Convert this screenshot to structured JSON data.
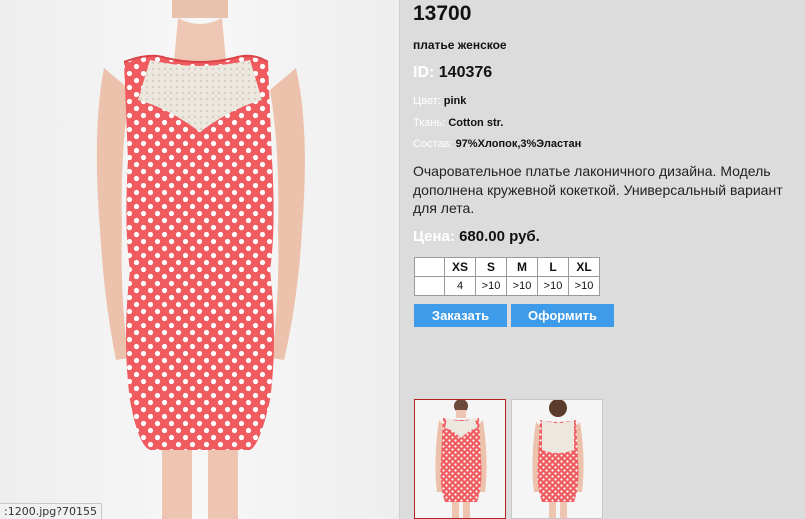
{
  "product": {
    "price_top": "13700",
    "subtitle": "платье женское",
    "id_label": "ID:",
    "id_value": "140376",
    "attributes": [
      {
        "key": "Цвет:",
        "value": "pink"
      },
      {
        "key": "Ткань:",
        "value": "Cotton str."
      },
      {
        "key": "Состав:",
        "value": "97%Хлопок,3%Эластан"
      }
    ],
    "description": "Очаровательное платье лаконичного дизайна. Модель дополнена кружевной кокеткой. Универсальный вариант для лета.",
    "price_label": "Цена:",
    "price_value": "680.00 руб."
  },
  "sizes": {
    "headers": [
      "",
      "XS",
      "S",
      "M",
      "L",
      "XL"
    ],
    "stock": [
      "",
      "4",
      ">10",
      ">10",
      ">10",
      ">10"
    ]
  },
  "buttons": {
    "order": "Заказать",
    "checkout": "Оформить"
  },
  "status_bar": {
    "url_text": ":1200.jpg?70155"
  },
  "colors": {
    "accent": "#3d9be9",
    "dress": "#ef5b5f",
    "selected_thumb_border": "#b52020"
  }
}
